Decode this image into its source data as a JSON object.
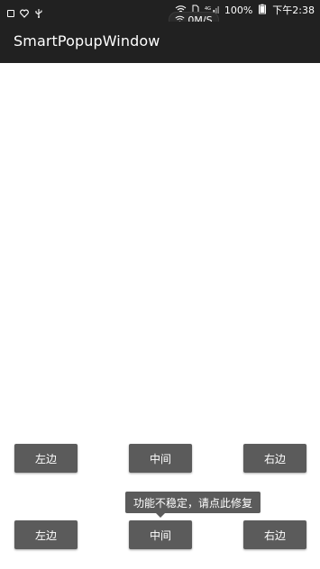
{
  "status_bar": {
    "battery_text": "100%",
    "time_text": "下午2:38",
    "net_speed": "0M/S"
  },
  "app_bar": {
    "title": "SmartPopupWindow"
  },
  "row_top": {
    "left_label": "左边",
    "center_label": "中间",
    "right_label": "右边"
  },
  "tooltip": {
    "text": "功能不稳定，请点此修复"
  },
  "row_bottom": {
    "left_label": "左边",
    "center_label": "中间",
    "right_label": "右边"
  },
  "colors": {
    "app_bar": "#212121",
    "button": "#5b5b5b",
    "background": "#ffffff"
  }
}
